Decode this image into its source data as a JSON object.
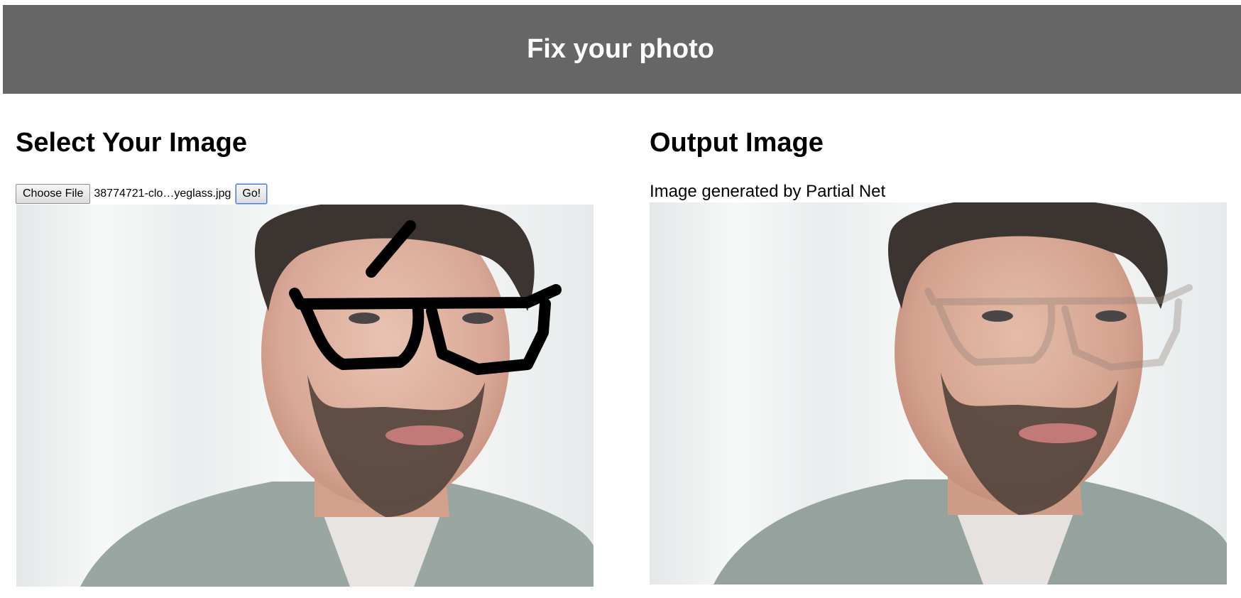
{
  "header": {
    "title": "Fix your photo"
  },
  "input_panel": {
    "title": "Select Your Image",
    "choose_file_label": "Choose File",
    "file_name": "38774721-clo…yeglass.jpg",
    "go_label": "Go!"
  },
  "output_panel": {
    "title": "Output Image",
    "caption": "Image generated by Partial Net"
  },
  "colors": {
    "header_bg": "#666666",
    "header_text": "#ffffff",
    "drawn_mask": "#000000"
  }
}
